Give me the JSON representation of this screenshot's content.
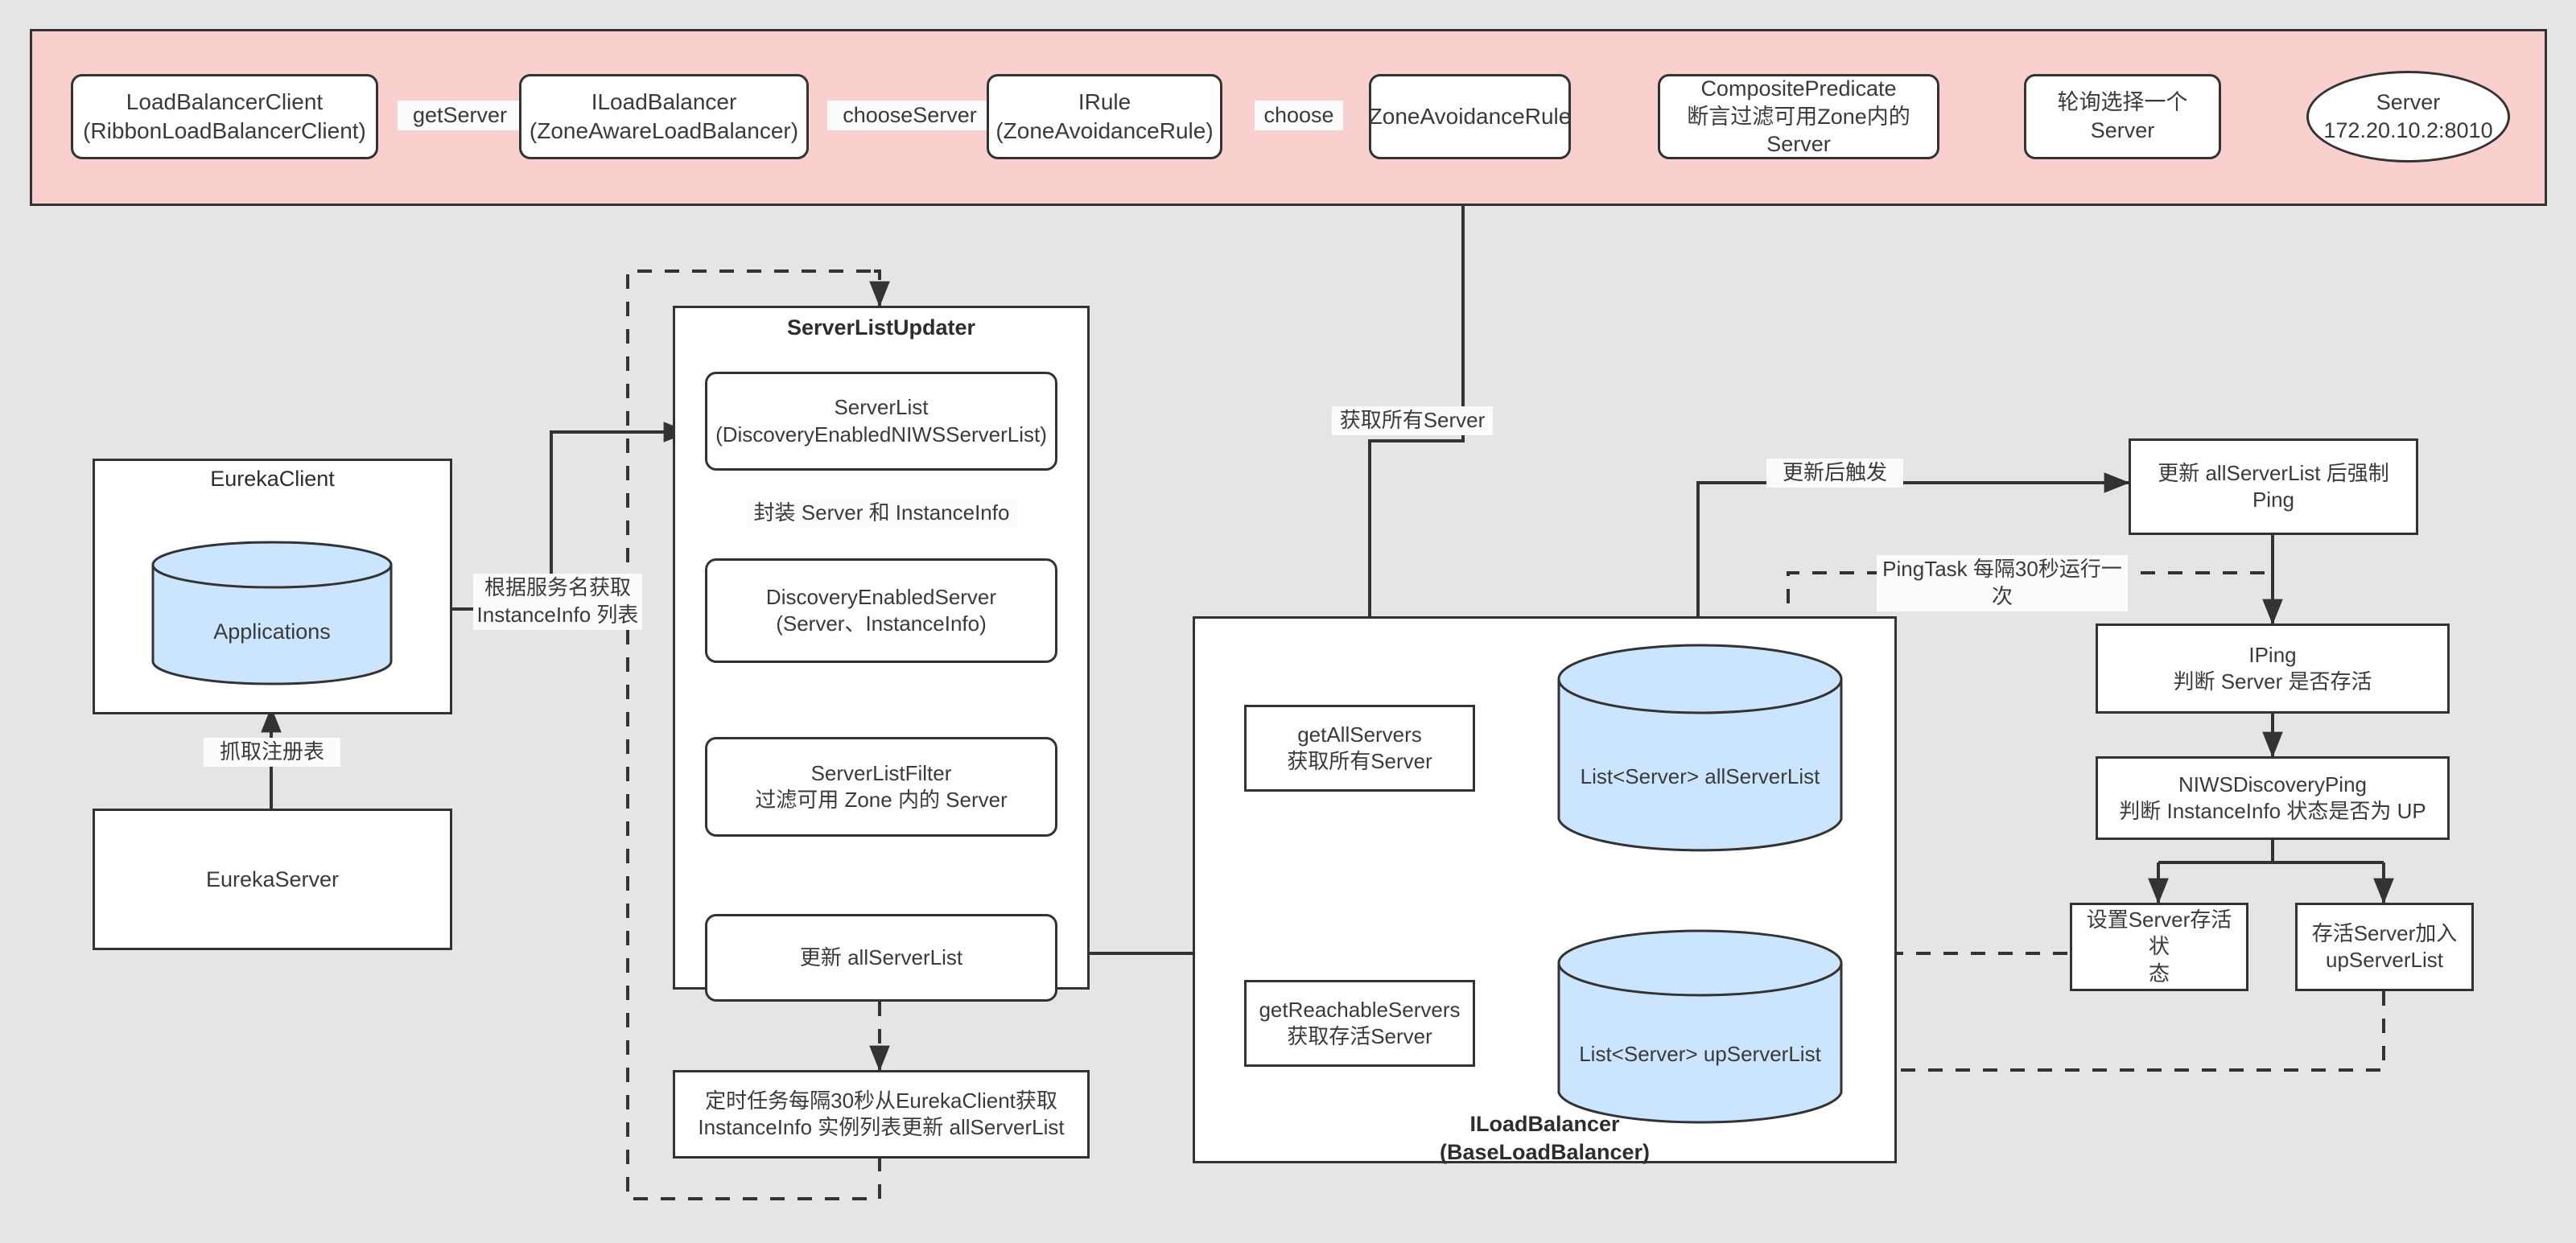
{
  "diagram": {
    "title": "Ribbon / Eureka Load Balancer Flow",
    "colors": {
      "canvas_bg": "#E5E5E5",
      "pink_group_bg": "#FAD0CE",
      "cylinder_fill": "#CCE5FF",
      "node_fill": "#FFFFFF",
      "stroke": "#333333",
      "text": "#3A3A3A"
    }
  },
  "pink_flow": {
    "nodes": [
      {
        "id": "load-balancer-client",
        "label": "LoadBalancerClient\n(RibbonLoadBalancerClient)"
      },
      {
        "id": "iload-balancer",
        "label": "ILoadBalancer\n(ZoneAwareLoadBalancer)"
      },
      {
        "id": "irule",
        "label": "IRule\n(ZoneAvoidanceRule)"
      },
      {
        "id": "zone-avoidance-rule",
        "label": "ZoneAvoidanceRule"
      },
      {
        "id": "composite-predicate",
        "label": "CompositePredicate\n断言过滤可用Zone内的Server"
      },
      {
        "id": "round-robin",
        "label": "轮询选择一个Server"
      },
      {
        "id": "server",
        "label": "Server\n172.20.10.2:8010"
      }
    ],
    "edge_labels": {
      "get_server": "getServer",
      "choose_server": "chooseServer",
      "choose": "choose"
    }
  },
  "eureka": {
    "client_title": "EurekaClient",
    "applications_cylinder": "Applications",
    "server_box": "EurekaServer",
    "fetch_registry_label": "抓取注册表",
    "get_instanceinfo_label": "根据服务名获取\nInstanceInfo 列表"
  },
  "server_list_updater": {
    "title": "ServerListUpdater",
    "nodes": [
      {
        "id": "server-list",
        "label": "ServerList\n(DiscoveryEnabledNIWSServerList)"
      },
      {
        "id": "discovery-enabled-server",
        "label": "DiscoveryEnabledServer\n(Server、InstanceInfo)"
      },
      {
        "id": "server-list-filter",
        "label": "ServerListFilter\n过滤可用 Zone 内的 Server"
      },
      {
        "id": "update-all-server-list",
        "label": "更新 allServerList"
      }
    ],
    "edge_labels": {
      "wrap": "封装 Server 和 InstanceInfo"
    },
    "scheduled_task": "定时任务每隔30秒从EurekaClient获取\nInstanceInfo 实例列表更新 allServerList"
  },
  "load_balancer_group": {
    "title": "ILoadBalancer\n(BaseLoadBalancer)",
    "get_all_servers": "getAllServers\n获取所有Server",
    "get_reachable_servers": "getReachableServers\n获取存活Server",
    "all_server_list_cylinder": "List<Server> allServerList",
    "up_server_list_cylinder": "List<Server> upServerList",
    "fetch_all_servers_label": "获取所有Server"
  },
  "ping_flow": {
    "force_ping": "更新 allServerList 后强制 Ping",
    "trigger_label": "更新后触发",
    "ping_task_label": "PingTask 每隔30秒运行一次",
    "iping": "IPing\n判断 Server 是否存活",
    "niws_discovery_ping": "NIWSDiscoveryPing\n判断 InstanceInfo 状态是否为 UP",
    "set_alive_status": "设置Server存活状\n态",
    "add_to_up_list": "存活Server加入\nupServerList"
  }
}
